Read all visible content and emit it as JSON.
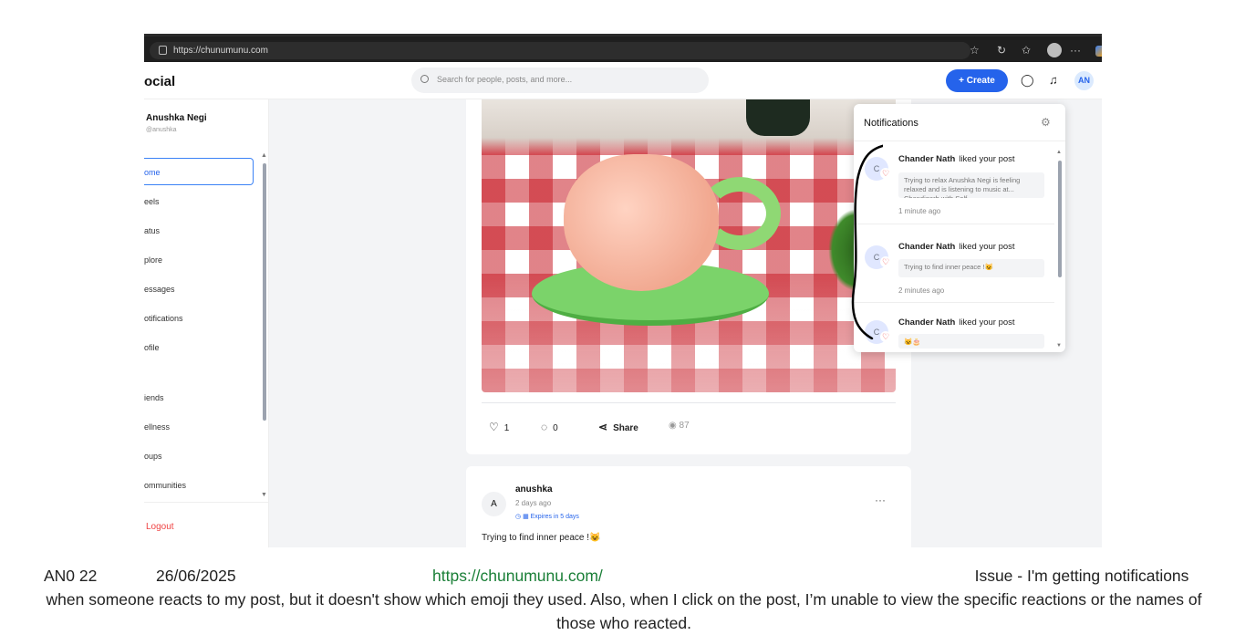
{
  "browser": {
    "url": "https://chunumunu.com"
  },
  "header": {
    "logo": "ocial",
    "search_placeholder": "Search for people, posts, and more...",
    "create_label": "+ Create",
    "avatar_initials": "AN"
  },
  "sidebar": {
    "user_name": "Anushka Negi",
    "user_handle": "@anushka",
    "items": [
      {
        "label": "ome"
      },
      {
        "label": "eels"
      },
      {
        "label": "atus"
      },
      {
        "label": "plore"
      },
      {
        "label": "essages"
      },
      {
        "label": "otifications"
      },
      {
        "label": "ofile"
      },
      {
        "label": "iends"
      },
      {
        "label": "ellness"
      },
      {
        "label": "oups"
      },
      {
        "label": "ommunities"
      }
    ],
    "logout_label": "Logout"
  },
  "post": {
    "likes": "1",
    "comments": "0",
    "share_label": "Share",
    "views": "87"
  },
  "post2": {
    "avatar": "A",
    "author": "anushka",
    "time": "2 days ago",
    "expires": "Expires in 5 days",
    "more": "···",
    "text": "Trying to find inner peace !😺"
  },
  "notifications": {
    "title": "Notifications",
    "items": [
      {
        "avatar": "C",
        "name": "Chander Nath",
        "action": "liked your post",
        "quote": "Trying to relax Anushka Negi is feeling relaxed and is listening to music at... Chandigarh with Self",
        "time": "1 minute ago"
      },
      {
        "avatar": "C",
        "name": "Chander Nath",
        "action": "liked your post",
        "quote": "Trying to find inner peace !😺",
        "time": "2 minutes ago"
      },
      {
        "avatar": "C",
        "name": "Chander Nath",
        "action": "liked your post",
        "quote": "😺🎂",
        "time": ""
      }
    ]
  },
  "caption": {
    "id": "AN0 22",
    "date": "26/06/2025",
    "url": "https://chunumunu.com/",
    "issue": "Issue - I'm getting notifications when someone reacts to my post, but it doesn't show which emoji they used. Also, when I click on the post, I’m unable to view the specific reactions or the names of those who reacted."
  }
}
